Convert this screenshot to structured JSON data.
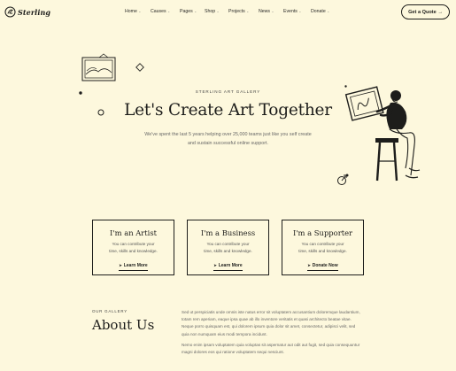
{
  "header": {
    "logo_text": "Sterling",
    "nav": [
      {
        "label": "Home",
        "has_dropdown": true
      },
      {
        "label": "Causes",
        "has_dropdown": true
      },
      {
        "label": "Pages",
        "has_dropdown": true
      },
      {
        "label": "Shop",
        "has_dropdown": true
      },
      {
        "label": "Projects",
        "has_dropdown": true
      },
      {
        "label": "News",
        "has_dropdown": true
      },
      {
        "label": "Events",
        "has_dropdown": true
      },
      {
        "label": "Donate",
        "has_dropdown": true
      }
    ],
    "cta_label": "Get a Quote",
    "cta_arrow": "→"
  },
  "hero": {
    "eyebrow": "STERLING ART GALLERY",
    "title": "Let's Create Art Together",
    "subtitle_line1": "We've spent the last 5 years helping over 25,000 teams just like you self create",
    "subtitle_line2": "and sustain successful online support."
  },
  "cards": [
    {
      "title": "I'm an Artist",
      "desc_line1": "You can contribute your",
      "desc_line2": "time, skills and knowledge.",
      "link": "Learn More"
    },
    {
      "title": "I'm a Business",
      "desc_line1": "You can contribute your",
      "desc_line2": "time, skills and knowledge.",
      "link": "Learn More"
    },
    {
      "title": "I'm a Supporter",
      "desc_line1": "You can contribute your",
      "desc_line2": "time, skills and knowledge.",
      "link": "Donate Now"
    }
  ],
  "about": {
    "eyebrow": "OUR GALLERY",
    "title": "About Us",
    "paragraph1": "Sed ut perspiciatis unde omnis iste natus error sit voluptatem accusantium doloremque laudantium, totam rem aperiam, eaque ipsa quae ab illo inventore veritatis et quasi architecto beatae vitae. Neque porro quisquam est, qui dolorem ipsum quia dolor sit amet, consectetur, adipisci velit, sed quia non numquam eius modi tempora incidunt.",
    "paragraph2": "Nemo enim ipsam voluptatem quia voluptas sit aspernatur aut odit aut fugit, sed quia consequuntur magni dolores eos qui ratione voluptatem sequi nesciunt."
  },
  "colors": {
    "background": "#fdf8dd",
    "ink": "#1d1d1b",
    "muted_text": "#666666"
  },
  "icons": [
    "logo-mark-icon",
    "chevron-down-icon",
    "arrow-right-icon",
    "framed-picture-icon",
    "diamond-icon",
    "dot-icon",
    "ring-icon",
    "artist-illustration",
    "target-circle-icon",
    "small-arrow-icon"
  ]
}
